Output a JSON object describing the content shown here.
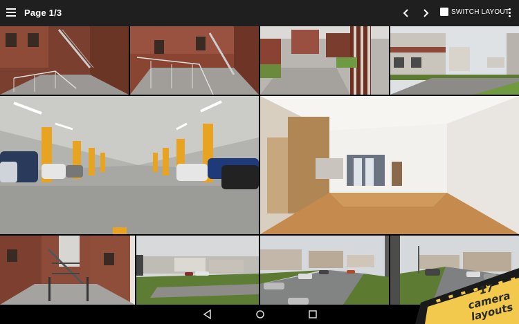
{
  "app_bar": {
    "page_title": "Page 1/3",
    "switch_layout_label": "SWITCH LAYOUT",
    "icons": [
      "menu-icon",
      "chevron-left-icon",
      "chevron-right-icon",
      "checkbox",
      "overflow-menu-icon"
    ]
  },
  "cameras": [
    {
      "id": "cam-1",
      "scene": "stairs-courtyard"
    },
    {
      "id": "cam-2",
      "scene": "ramp-courtyard"
    },
    {
      "id": "cam-3",
      "scene": "building-entrance"
    },
    {
      "id": "cam-4",
      "scene": "street-houses"
    },
    {
      "id": "cam-5",
      "scene": "parking-garage"
    },
    {
      "id": "cam-6",
      "scene": "empty-room"
    },
    {
      "id": "cam-7",
      "scene": "courtyard-stairs"
    },
    {
      "id": "cam-8",
      "scene": "lawn-houses"
    },
    {
      "id": "cam-9",
      "scene": "street-cars"
    },
    {
      "id": "cam-10",
      "scene": "street-parking"
    }
  ],
  "badge": {
    "line1": "17 camera",
    "line2": "layouts",
    "color": "#f2c94c"
  },
  "system_nav": {
    "icons": [
      "back-icon",
      "home-icon",
      "recents-icon"
    ]
  },
  "colors": {
    "app_bar": "#1f1f1f",
    "brick": "#8a4a37",
    "badge_yellow": "#f2c94c"
  }
}
